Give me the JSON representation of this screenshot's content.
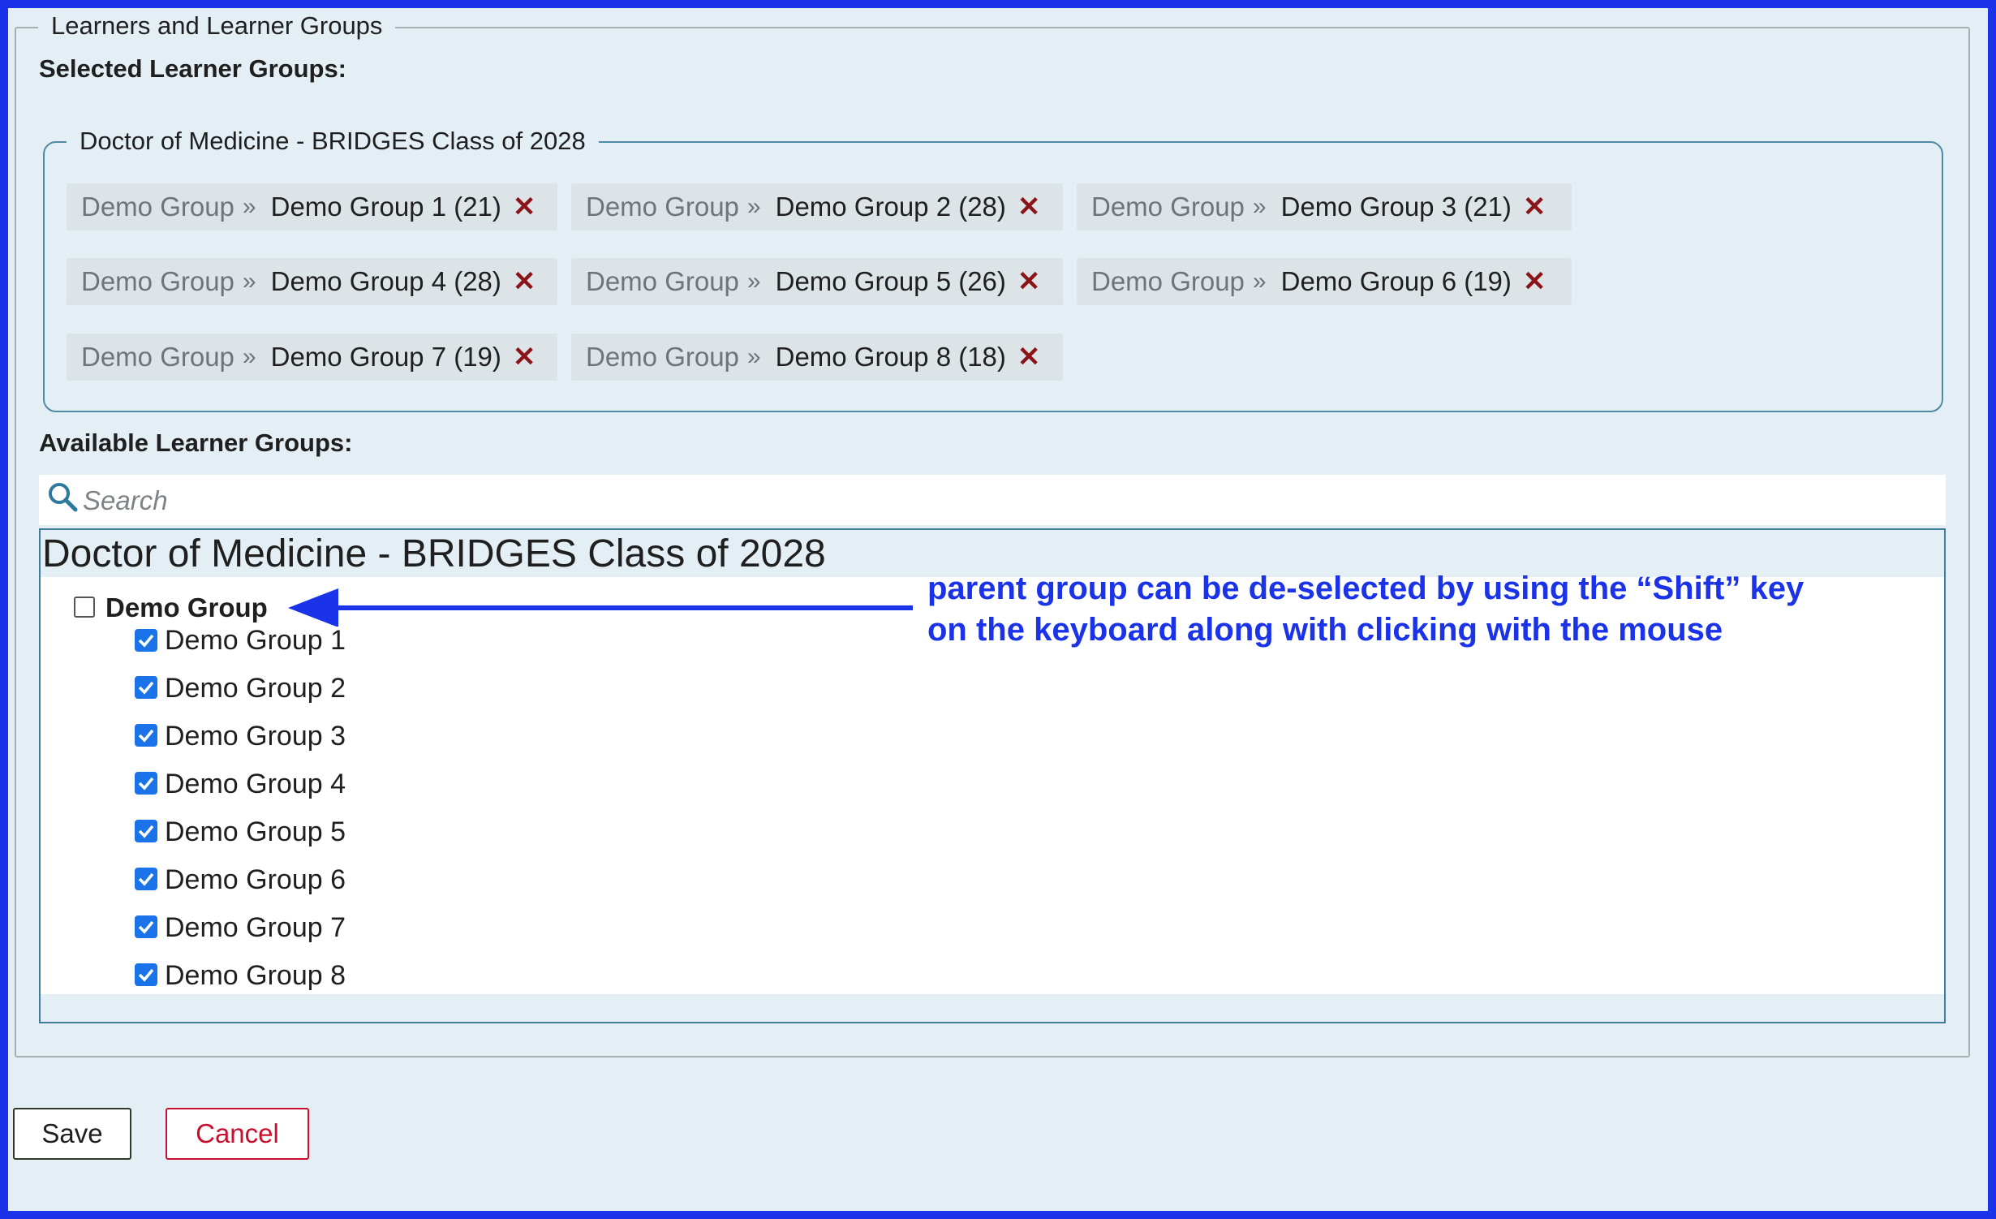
{
  "outer_legend": "Learners and Learner Groups",
  "selected_label": "Selected Learner Groups:",
  "cohort_legend": "Doctor of Medicine - BRIDGES Class of 2028",
  "chip_separator": "»",
  "chip_remove_glyph": "✕",
  "selected_chips": [
    {
      "parent": "Demo Group",
      "child": "Demo Group 1 (21)"
    },
    {
      "parent": "Demo Group",
      "child": "Demo Group 2 (28)"
    },
    {
      "parent": "Demo Group",
      "child": "Demo Group 3 (21)"
    },
    {
      "parent": "Demo Group",
      "child": "Demo Group 4 (28)"
    },
    {
      "parent": "Demo Group",
      "child": "Demo Group 5 (26)"
    },
    {
      "parent": "Demo Group",
      "child": "Demo Group 6 (19)"
    },
    {
      "parent": "Demo Group",
      "child": "Demo Group 7 (19)"
    },
    {
      "parent": "Demo Group",
      "child": "Demo Group 8 (18)"
    }
  ],
  "available_label": "Available Learner Groups:",
  "search": {
    "placeholder": "Search",
    "value": ""
  },
  "tree": {
    "title": "Doctor of Medicine - BRIDGES Class of 2028",
    "parent": {
      "label": "Demo Group",
      "checked": false
    },
    "children": [
      {
        "label": "Demo Group 1",
        "checked": true
      },
      {
        "label": "Demo Group 2",
        "checked": true
      },
      {
        "label": "Demo Group 3",
        "checked": true
      },
      {
        "label": "Demo Group 4",
        "checked": true
      },
      {
        "label": "Demo Group 5",
        "checked": true
      },
      {
        "label": "Demo Group 6",
        "checked": true
      },
      {
        "label": "Demo Group 7",
        "checked": true
      },
      {
        "label": "Demo Group 8",
        "checked": true
      }
    ]
  },
  "annotation": {
    "line1": "parent group can be de-selected by using the “Shift” key",
    "line2": "on the keyboard along with clicking with the mouse",
    "color": "#1a33e8"
  },
  "buttons": {
    "save": "Save",
    "cancel": "Cancel"
  },
  "colors": {
    "frame": "#1a33e8",
    "checkbox": "#1a73e8",
    "remove_x": "#8a1418",
    "cancel": "#c8102e"
  }
}
